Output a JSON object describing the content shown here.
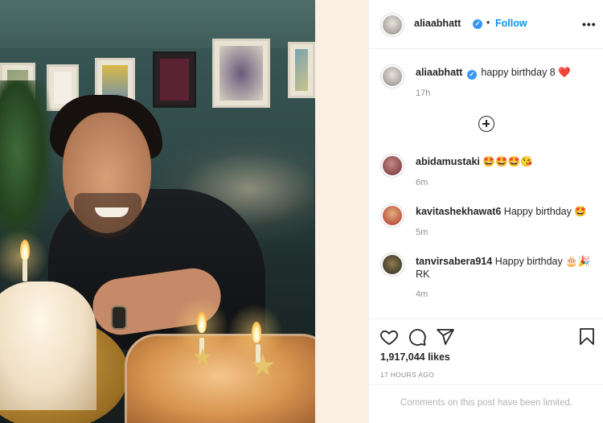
{
  "header": {
    "username": "aliaabhatt",
    "separator": "•",
    "follow_label": "Follow",
    "more_label": "•••"
  },
  "caption": {
    "username": "aliaabhatt",
    "text": "happy birthday 8",
    "emoji": "❤️",
    "time": "17h"
  },
  "comments": [
    {
      "username": "abidamustaki",
      "text": "🤩🤩🤩😘",
      "time": "6m"
    },
    {
      "username": "kavitashekhawat6",
      "text": "Happy birthday 🤩",
      "time": "5m"
    },
    {
      "username": "tanvirsabera914",
      "text": "Happy birthday 🎂🎉",
      "text2": "RK",
      "time": "4m"
    }
  ],
  "actions": {
    "likes": "1,917,044 likes",
    "post_time": "17 HOURS AGO"
  },
  "footer": {
    "limited_text": "Comments on this post have been limited."
  },
  "icons": [
    "heart-icon",
    "comment-icon",
    "share-icon",
    "bookmark-icon",
    "add-comment-icon",
    "verified-badge-icon",
    "more-options-icon"
  ],
  "colors": {
    "link_blue": "#0095f6",
    "verified_blue": "#3897f0",
    "muted_gray": "#8e8e8e",
    "heart_red": "#ed4956"
  }
}
